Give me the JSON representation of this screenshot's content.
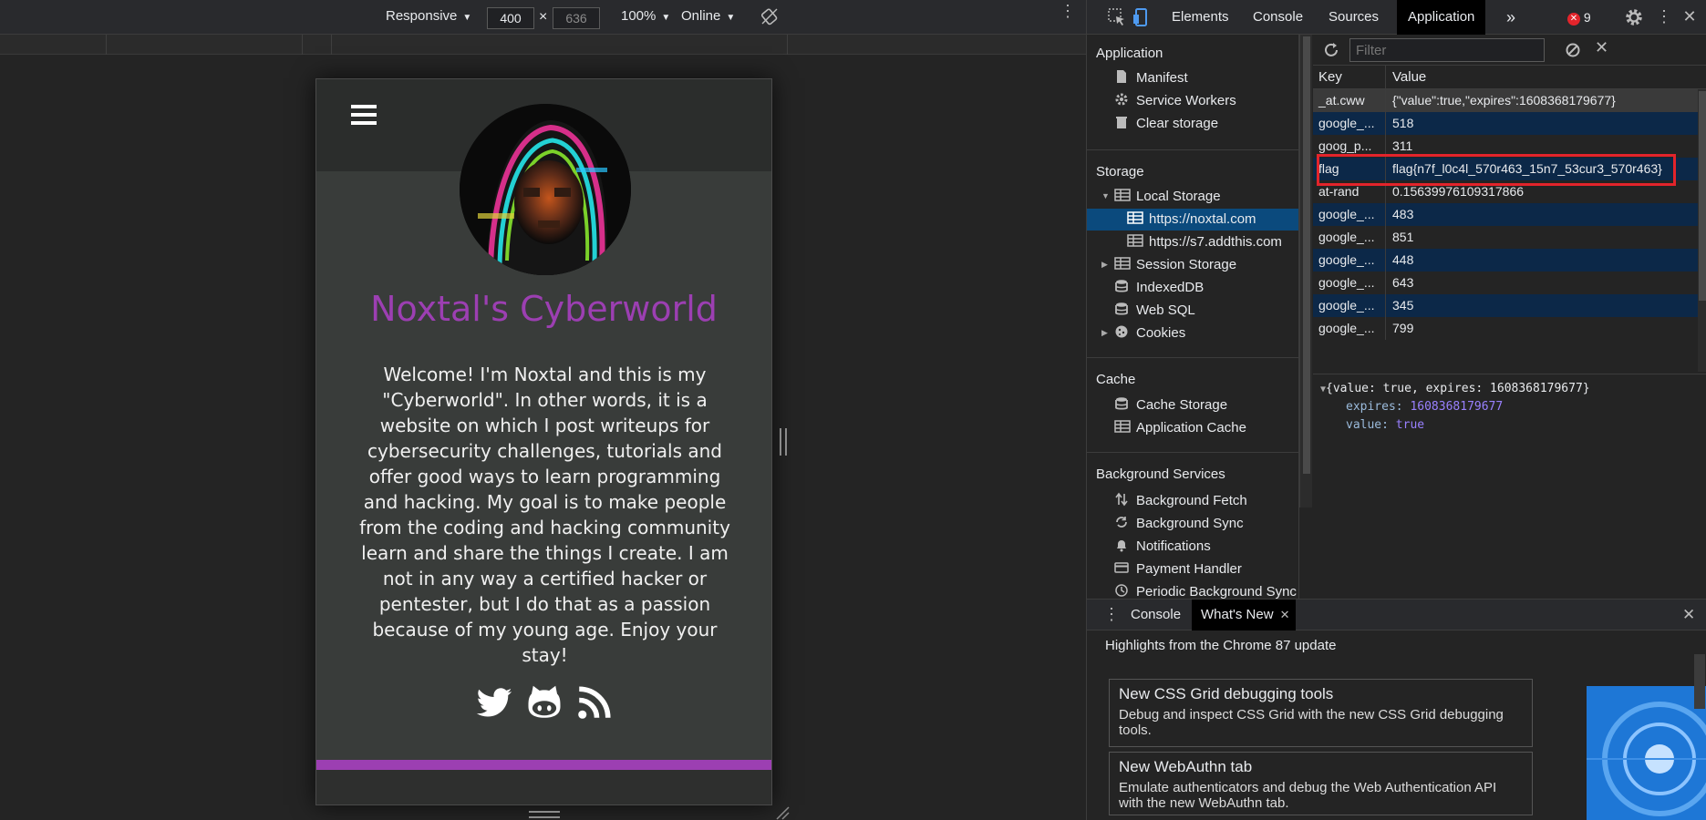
{
  "device_toolbar": {
    "device": "Responsive",
    "width": "400",
    "height": "636",
    "times": "×",
    "zoom": "100%",
    "network": "Online"
  },
  "site": {
    "title": "Noxtal's Cyberworld",
    "intro": "Welcome! I'm Noxtal and this is my \"Cyberworld\". In other words, it is a website on which I post writeups for cybersecurity challenges, tutorials and offer good ways to learn programming and hacking. My goal is to make people from the coding and hacking community learn and share the things I create. I am not in any way a certified hacker or pentester, but I do that as a passion because of my young age. Enjoy your stay!",
    "social_icons": [
      "twitter-icon",
      "github-icon",
      "rss-icon"
    ],
    "accent_color": "#9c3fb2"
  },
  "devtools": {
    "tabs": [
      "Elements",
      "Console",
      "Sources",
      "Application"
    ],
    "active_tab": "Application",
    "more_tabs": "»",
    "error_count": "9",
    "sidebar": {
      "application_header": "Application",
      "application_items": [
        "Manifest",
        "Service Workers",
        "Clear storage"
      ],
      "storage_header": "Storage",
      "local_storage": "Local Storage",
      "local_storage_children": [
        "https://noxtal.com",
        "https://s7.addthis.com"
      ],
      "storage_items": [
        "Session Storage",
        "IndexedDB",
        "Web SQL",
        "Cookies"
      ],
      "cache_header": "Cache",
      "cache_items": [
        "Cache Storage",
        "Application Cache"
      ],
      "bg_header": "Background Services",
      "bg_items": [
        "Background Fetch",
        "Background Sync",
        "Notifications",
        "Payment Handler",
        "Periodic Background Sync"
      ]
    },
    "storage": {
      "filter_placeholder": "Filter",
      "col_key": "Key",
      "col_value": "Value",
      "rows": [
        {
          "key": "_at.cww",
          "value": "{\"value\":true,\"expires\":1608368179677}"
        },
        {
          "key": "google_...",
          "value": "518"
        },
        {
          "key": "goog_p...",
          "value": "311"
        },
        {
          "key": "flag",
          "value": "flag{n7f_l0c4l_570r463_15n7_53cur3_570r463}"
        },
        {
          "key": "at-rand",
          "value": "0.15639976109317866"
        },
        {
          "key": "google_...",
          "value": "483"
        },
        {
          "key": "google_...",
          "value": "851"
        },
        {
          "key": "google_...",
          "value": "448"
        },
        {
          "key": "google_...",
          "value": "643"
        },
        {
          "key": "google_...",
          "value": "345"
        },
        {
          "key": "google_...",
          "value": "799"
        }
      ],
      "highlight_color": "#e3242b",
      "preview": {
        "summary": "{value: true, expires: 1608368179677}",
        "expires_key": "expires:",
        "expires_val": "1608368179677",
        "value_key": "value:",
        "value_val": "true"
      }
    },
    "drawer": {
      "tabs": [
        "Console",
        "What's New"
      ],
      "active_tab": "What's New",
      "highlights": "Highlights from the Chrome 87 update",
      "cards": [
        {
          "title": "New CSS Grid debugging tools",
          "desc": "Debug and inspect CSS Grid with the new CSS Grid debugging tools."
        },
        {
          "title": "New WebAuthn tab",
          "desc": "Emulate authenticators and debug the Web Authentication API with the new WebAuthn tab."
        }
      ]
    }
  }
}
